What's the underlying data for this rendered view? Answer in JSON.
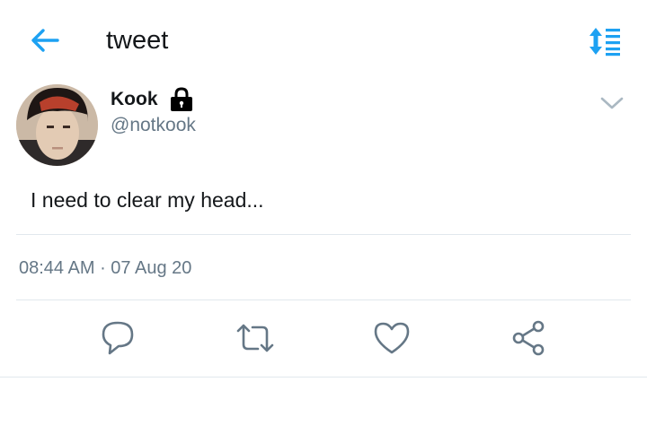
{
  "header": {
    "title": "tweet",
    "back_icon": "arrow-left-icon",
    "sort_icon": "sort-updown-icon",
    "accent_color": "#1da1f2"
  },
  "tweet": {
    "author": {
      "name": "Kook",
      "handle": "@notkook",
      "protected": true,
      "lock_icon": "lock-icon"
    },
    "text": "I need to clear my head...",
    "time": "08:44 AM",
    "separator": " · ",
    "date": "07 Aug 20",
    "menu_icon": "chevron-down-icon"
  },
  "actions": [
    {
      "name": "reply",
      "icon": "comment-icon"
    },
    {
      "name": "retweet",
      "icon": "retweet-icon"
    },
    {
      "name": "like",
      "icon": "heart-icon"
    },
    {
      "name": "share",
      "icon": "share-icon"
    }
  ]
}
